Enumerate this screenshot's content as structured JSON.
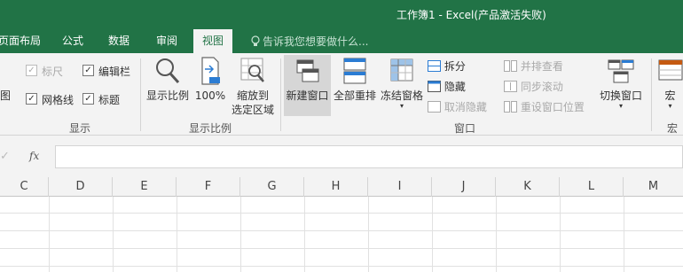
{
  "window": {
    "title": "工作簿1 - Excel(产品激活失败)"
  },
  "tabs": [
    {
      "label": "页面布局"
    },
    {
      "label": "公式"
    },
    {
      "label": "数据"
    },
    {
      "label": "审阅"
    },
    {
      "label": "视图"
    }
  ],
  "tell_me": {
    "text": "告诉我您想要做什么..."
  },
  "ribbon": {
    "show_group": {
      "label": "显示",
      "ruler": "标尺",
      "formula_bar": "编辑栏",
      "gridlines": "网格线",
      "headings": "标题",
      "view_cut": "图"
    },
    "zoom_group": {
      "label": "显示比例",
      "zoom": "显示比例",
      "zoom100": "100%",
      "zoom_sel_1": "缩放到",
      "zoom_sel_2": "选定区域"
    },
    "window_group": {
      "label": "窗口",
      "new_window": "新建窗口",
      "arrange_all": "全部重排",
      "freeze_panes": "冻结窗格",
      "split": "拆分",
      "hide": "隐藏",
      "unhide": "取消隐藏",
      "side_by_side": "并排查看",
      "sync_scroll": "同步滚动",
      "reset_pos": "重设窗口位置",
      "switch_windows": "切换窗口"
    },
    "macros_group": {
      "label": "宏",
      "macros": "宏"
    }
  },
  "formula_bar": {
    "fx": "fx",
    "value": ""
  },
  "columns": [
    "C",
    "D",
    "E",
    "F",
    "G",
    "H",
    "I",
    "J",
    "K",
    "L",
    "M"
  ],
  "colors": {
    "excel_green": "#217346",
    "ribbon_bg": "#f3f3f3"
  }
}
